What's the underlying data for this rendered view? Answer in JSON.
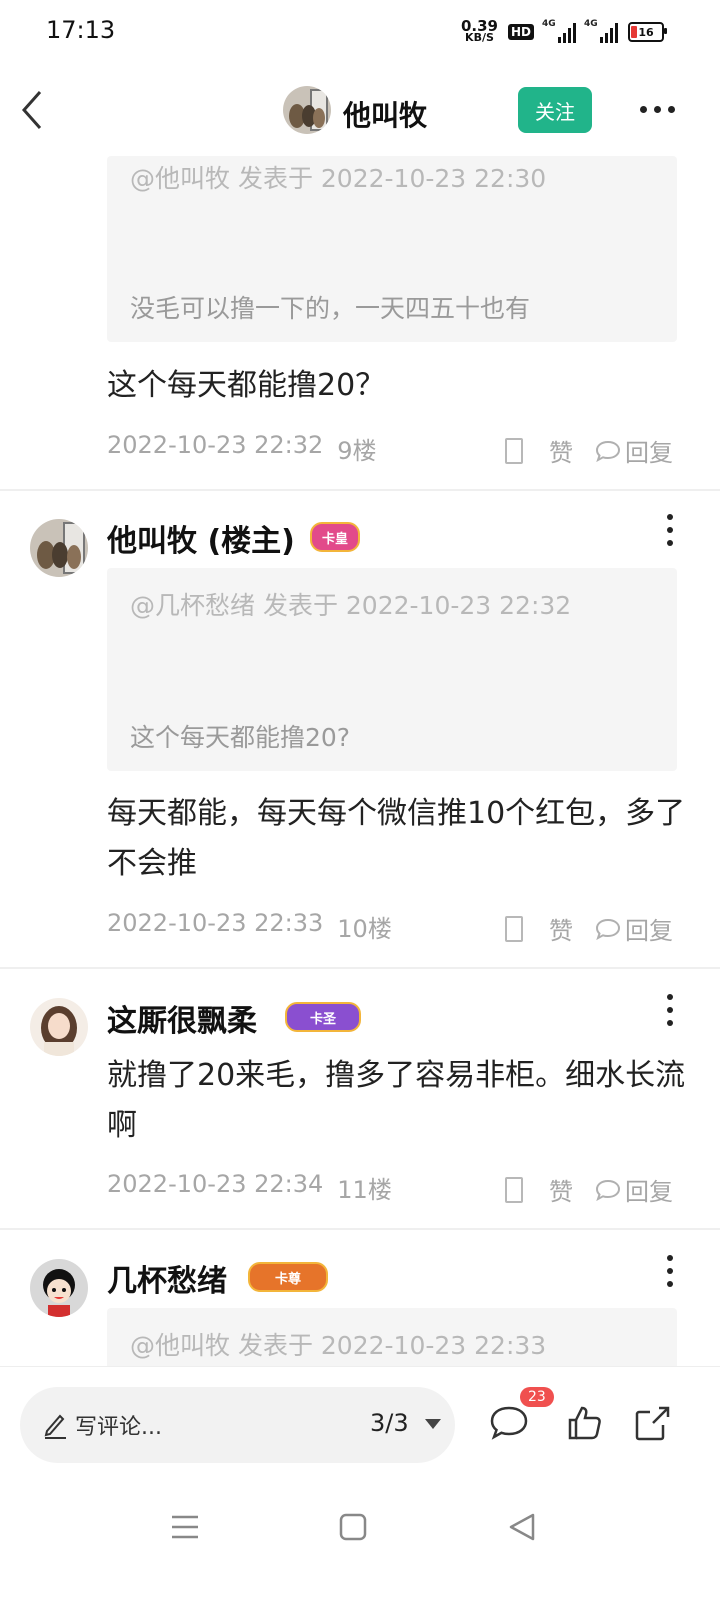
{
  "status_bar": {
    "time": "17:13",
    "net_speed": "0.39",
    "net_unit": "KB/S",
    "hd": "HD",
    "signal_1": "4G",
    "signal_2": "4G",
    "battery": "16"
  },
  "header": {
    "title": "他叫牧",
    "follow_label": "关注"
  },
  "posts": [
    {
      "quote_meta": "@他叫牧 发表于 2022-10-23 22:30",
      "quote_text": "没毛可以撸一下的，一天四五十也有",
      "body": "这个每天都能撸20？",
      "time": "2022-10-23 22:32",
      "floor": "9楼",
      "like_label": "赞",
      "reply_label": "回复"
    },
    {
      "author": "他叫牧 (楼主)",
      "badge": "卡皇",
      "quote_meta": "@几杯愁绪 发表于 2022-10-23 22:32",
      "quote_text": "这个每天都能撸20?",
      "body": "每天都能，每天每个微信推10个红包，多了不会推",
      "time": "2022-10-23 22:33",
      "floor": "10楼",
      "like_label": "赞",
      "reply_label": "回复"
    },
    {
      "author": "这厮很飘柔",
      "badge": "卡圣",
      "body": "就撸了20来毛，撸多了容易非柜。细水长流啊",
      "time": "2022-10-23 22:34",
      "floor": "11楼",
      "like_label": "赞",
      "reply_label": "回复"
    },
    {
      "author": "几杯愁绪",
      "badge": "卡尊",
      "quote_meta": "@他叫牧 发表于 2022-10-23 22:33"
    }
  ],
  "bottom_bar": {
    "comment_placeholder": "写评论...",
    "page_indicator": "3/3",
    "comment_count": "23"
  },
  "colors": {
    "accent": "#21b48a",
    "badge_red": "#f0504f"
  }
}
